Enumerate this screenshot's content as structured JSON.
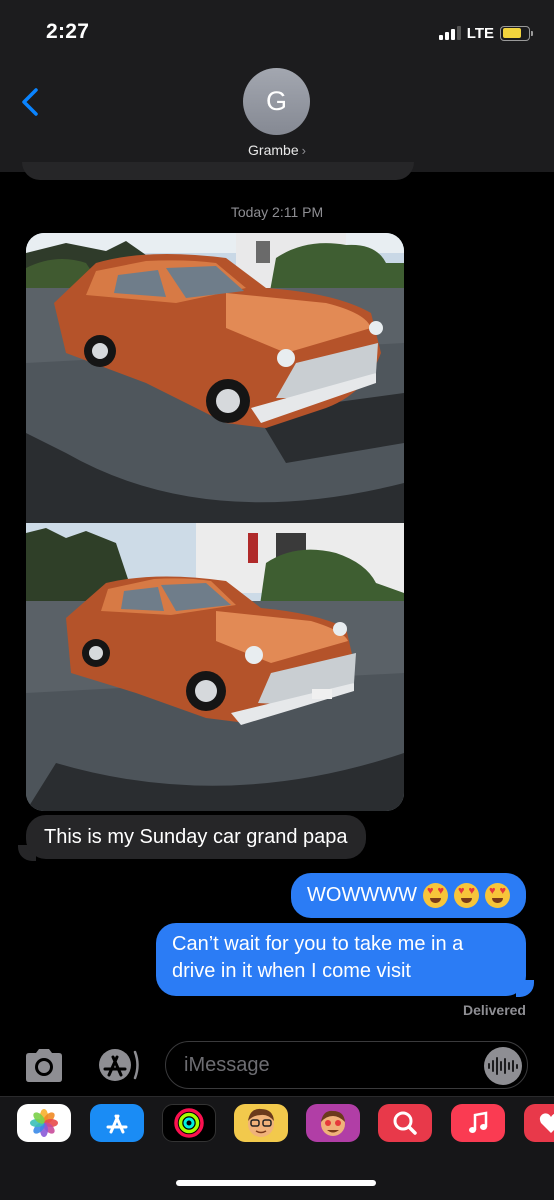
{
  "status_bar": {
    "time": "2:27",
    "network": "LTE"
  },
  "header": {
    "avatar_initial": "G",
    "contact_name": "Grambe",
    "contact_chevron": "›"
  },
  "conversation": {
    "timestamp": "Today 2:11 PM",
    "incoming": [
      {
        "type": "photo",
        "subject": "orange vintage sedan"
      },
      {
        "type": "photo",
        "subject": "orange vintage sedan"
      },
      {
        "type": "text",
        "text": "This is my Sunday car grand papa"
      }
    ],
    "outgoing": [
      {
        "text": "WOWWWW",
        "emoji_count": 3
      },
      {
        "text": "Can’t wait for you to take me in a drive in it when I come visit"
      }
    ],
    "receipt": "Delivered"
  },
  "input_bar": {
    "placeholder": "iMessage"
  },
  "app_drawer": {
    "apps": [
      "photos-app",
      "app-store-app",
      "activity-app",
      "memoji-stickers-app",
      "animoji-stickers-app",
      "web-images-app",
      "music-app",
      "digital-touch-app"
    ]
  },
  "colors": {
    "header_bg": "#1c1c1e",
    "incoming_bubble": "#262628",
    "outgoing_bubble": "#2b7cf5",
    "ios_blue": "#0a84ff",
    "secondary_text": "#8e8e93",
    "battery_fill": "#f2d43d"
  }
}
